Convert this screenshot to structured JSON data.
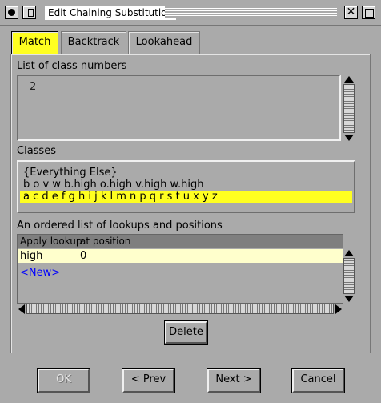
{
  "window": {
    "title": "Edit Chaining Substitution"
  },
  "tabs": [
    {
      "label": "Match",
      "selected": true
    },
    {
      "label": "Backtrack",
      "selected": false
    },
    {
      "label": "Lookahead",
      "selected": false
    }
  ],
  "class_numbers": {
    "label": "List of class numbers",
    "value": "2"
  },
  "classes": {
    "label": "Classes",
    "items": [
      "{Everything Else}",
      "b o v w b.high o.high v.high w.high",
      "a c d e f g h i j k l m n p q r s t u x y z"
    ],
    "selected_index": 2
  },
  "lookups": {
    "label": "An ordered list of lookups and positions",
    "columns": [
      "Apply lookup",
      "at position"
    ],
    "rows": [
      {
        "lookup": "high",
        "position": "0"
      }
    ],
    "new_label": "<New>"
  },
  "buttons": {
    "delete": "Delete",
    "ok": "OK",
    "prev": "< Prev",
    "next": "Next >",
    "cancel": "Cancel"
  },
  "colors": {
    "selection": "#ffff20",
    "row_highlight": "#ffffcc",
    "background": "#aaaaaa",
    "new_link": "#0000ff"
  }
}
